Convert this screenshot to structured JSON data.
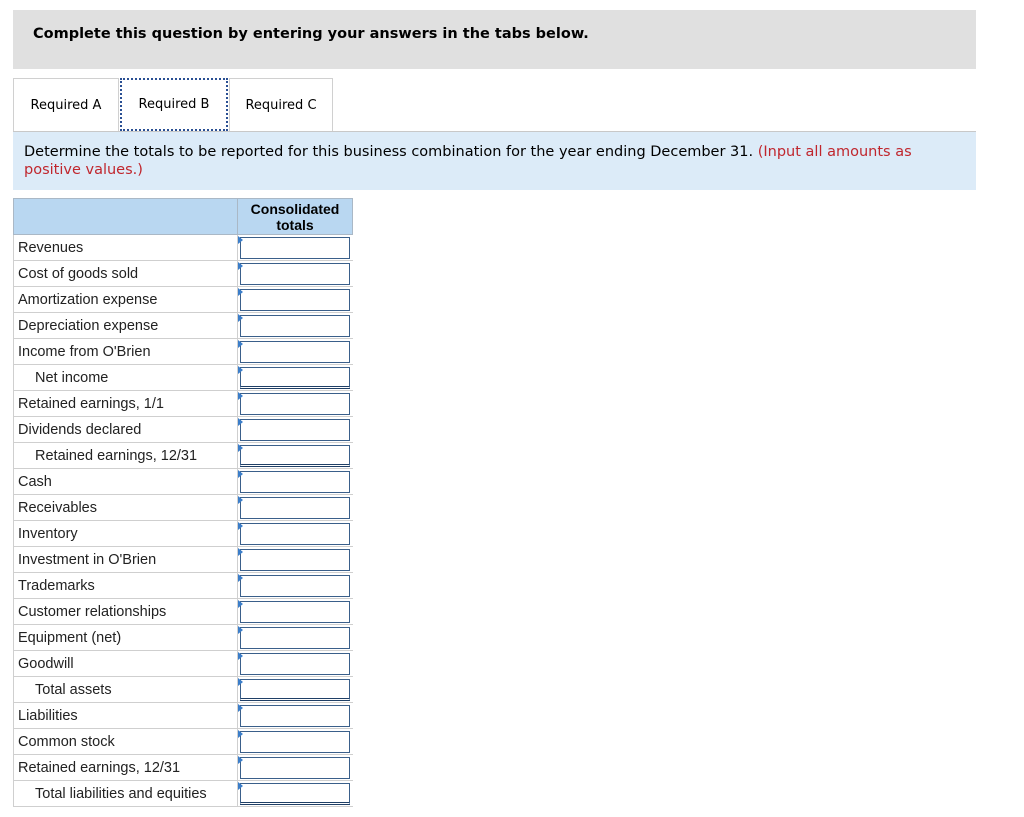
{
  "banner": {
    "title": "Complete this question by entering your answers in the tabs below."
  },
  "tabs": [
    {
      "label": "Required A"
    },
    {
      "label": "Required B"
    },
    {
      "label": "Required C"
    }
  ],
  "instruction": {
    "text": "Determine the totals to be reported for this business combination for the year ending December 31. ",
    "note": "(Input all amounts as positive values.)"
  },
  "table": {
    "column_header": "Consolidated totals",
    "rows": [
      {
        "label": "Revenues",
        "indent": false,
        "total": false,
        "value": ""
      },
      {
        "label": "Cost of goods sold",
        "indent": false,
        "total": false,
        "value": ""
      },
      {
        "label": "Amortization expense",
        "indent": false,
        "total": false,
        "value": ""
      },
      {
        "label": "Depreciation expense",
        "indent": false,
        "total": false,
        "value": ""
      },
      {
        "label": "Income from O'Brien",
        "indent": false,
        "total": false,
        "value": ""
      },
      {
        "label": "Net income",
        "indent": true,
        "total": true,
        "value": ""
      },
      {
        "label": "Retained earnings, 1/1",
        "indent": false,
        "total": false,
        "value": ""
      },
      {
        "label": "Dividends declared",
        "indent": false,
        "total": false,
        "value": ""
      },
      {
        "label": "Retained earnings, 12/31",
        "indent": true,
        "total": true,
        "value": ""
      },
      {
        "label": "Cash",
        "indent": false,
        "total": false,
        "value": ""
      },
      {
        "label": "Receivables",
        "indent": false,
        "total": false,
        "value": ""
      },
      {
        "label": "Inventory",
        "indent": false,
        "total": false,
        "value": ""
      },
      {
        "label": "Investment in O'Brien",
        "indent": false,
        "total": false,
        "value": ""
      },
      {
        "label": "Trademarks",
        "indent": false,
        "total": false,
        "value": ""
      },
      {
        "label": "Customer relationships",
        "indent": false,
        "total": false,
        "value": ""
      },
      {
        "label": "Equipment (net)",
        "indent": false,
        "total": false,
        "value": ""
      },
      {
        "label": "Goodwill",
        "indent": false,
        "total": false,
        "value": ""
      },
      {
        "label": "Total assets",
        "indent": true,
        "total": true,
        "value": ""
      },
      {
        "label": "Liabilities",
        "indent": false,
        "total": false,
        "value": ""
      },
      {
        "label": "Common stock",
        "indent": false,
        "total": false,
        "value": ""
      },
      {
        "label": "Retained earnings, 12/31",
        "indent": false,
        "total": false,
        "value": ""
      },
      {
        "label": "Total liabilities and equities",
        "indent": true,
        "total": true,
        "value": ""
      }
    ]
  }
}
